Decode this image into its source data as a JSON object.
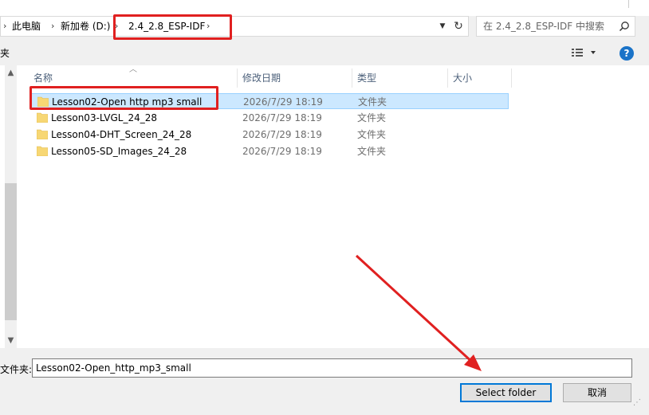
{
  "breadcrumbs": [
    "此电脑",
    "新加卷 (D:)",
    "2.4_2.8_ESP-IDF"
  ],
  "search": {
    "placeholder": "在 2.4_2.8_ESP-IDF 中搜索"
  },
  "toolbar": {
    "new_folder_fragment": "夹"
  },
  "columns": {
    "name": "名称",
    "modified": "修改日期",
    "type": "类型",
    "size": "大小"
  },
  "files": [
    {
      "name": "Lesson02-Open http mp3 small",
      "modified": "2026/7/29 18:19",
      "type": "文件夹",
      "selected": true
    },
    {
      "name": "Lesson03-LVGL_24_28",
      "modified": "2026/7/29 18:19",
      "type": "文件夹",
      "selected": false
    },
    {
      "name": "Lesson04-DHT_Screen_24_28",
      "modified": "2026/7/29 18:19",
      "type": "文件夹",
      "selected": false
    },
    {
      "name": "Lesson05-SD_Images_24_28",
      "modified": "2026/7/29 18:19",
      "type": "文件夹",
      "selected": false
    }
  ],
  "filename": {
    "label": "文件夹:",
    "value": "Lesson02-Open_http_mp3_small"
  },
  "buttons": {
    "select": "Select folder",
    "cancel": "取消"
  },
  "colors": {
    "selection": "#cce8ff",
    "annotation": "#e02020",
    "accent": "#0078d7"
  }
}
